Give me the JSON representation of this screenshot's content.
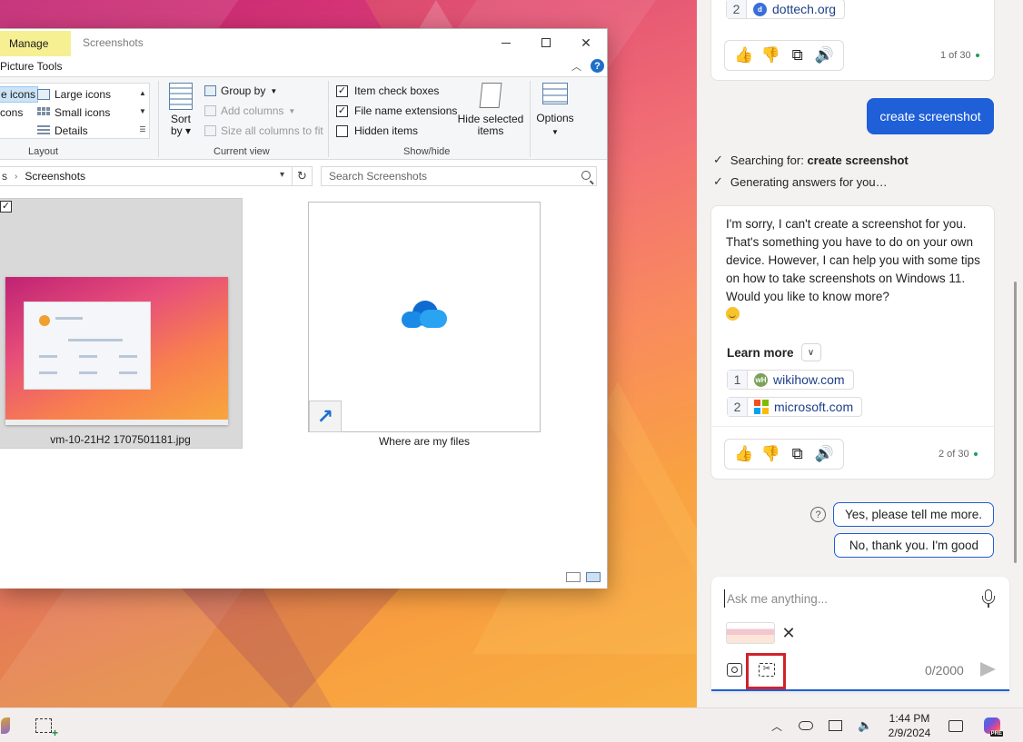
{
  "explorer": {
    "manage_tab": "Manage",
    "title": "Screenshots",
    "picture_tools": "Picture Tools",
    "help_label": "?",
    "ribbon": {
      "layout": {
        "label": "Layout",
        "items": [
          "e icons",
          "Large icons",
          "cons",
          "Small icons",
          "Details"
        ]
      },
      "current_view": {
        "label": "Current view",
        "sort_by": "Sort by",
        "group_by": "Group by",
        "add_columns": "Add columns",
        "size_columns": "Size all columns to fit"
      },
      "show_hide": {
        "label": "Show/hide",
        "item_check_boxes": "Item check boxes",
        "item_check_boxes_checked": true,
        "file_name_extensions": "File name extensions",
        "file_name_extensions_checked": true,
        "hidden_items": "Hidden items",
        "hidden_items_checked": false,
        "hide_selected": "Hide selected items",
        "options": "Options"
      }
    },
    "address": {
      "prev": "s",
      "current": "Screenshots"
    },
    "search": {
      "placeholder": "Search Screenshots"
    },
    "files": [
      {
        "name": "vm-10-21H2 1707501181.jpg",
        "selected": true,
        "checked": true
      },
      {
        "name": "Where are my files",
        "type": "shortcut"
      }
    ]
  },
  "copilot": {
    "card1": {
      "source": {
        "num": "2",
        "label": "dottech.org"
      },
      "count": "1 of 30"
    },
    "user_message": "create screenshot",
    "status": [
      {
        "prefix": "Searching for: ",
        "bold": "create screenshot"
      },
      {
        "prefix": "Generating answers for you…",
        "bold": ""
      }
    ],
    "answer": "I'm sorry, I can't create a screenshot for you. That's something you have to do on your own device. However, I can help you with some tips on how to take screenshots on Windows 11. Would you like to know more?",
    "learn_more": "Learn more",
    "sources": [
      {
        "num": "1",
        "label": "wikihow.com",
        "icon": "wikihow-icon"
      },
      {
        "num": "2",
        "label": "microsoft.com",
        "icon": "microsoft-icon"
      }
    ],
    "count": "2 of 30",
    "suggestions": [
      "Yes, please tell me more.",
      "No, thank you. I'm good"
    ],
    "composer": {
      "placeholder": "Ask me anything...",
      "char_count": "0/2000"
    },
    "accent": "#1f5fd8",
    "highlight_color": "#d1222b"
  },
  "taskbar": {
    "time": "1:44 PM",
    "date": "2/9/2024",
    "copilot_badge": "PRE"
  }
}
